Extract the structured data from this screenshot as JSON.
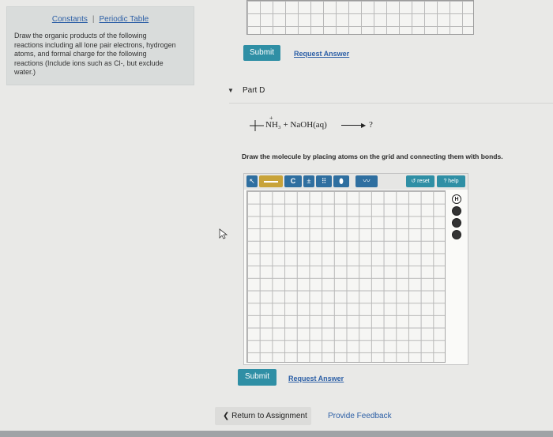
{
  "info": {
    "constants_link": "Constants",
    "periodic_link": "Periodic Table",
    "instructions_lines": [
      "Draw the organic products of the following",
      "reactions including all lone pair electrons, hydrogen",
      "atoms, and formal charge for the following",
      "reactions (Include ions such as Cl-, but exclude",
      "water.)"
    ]
  },
  "previous_part": {
    "submit_label": "Submit",
    "request_answer_label": "Request Answer"
  },
  "part_d": {
    "title": "Part D",
    "equation": {
      "reactants": "NH₃ + NaOH(aq)",
      "product": "?",
      "charge": "+"
    },
    "prompt": "Draw the molecule by placing atoms on the grid and connecting them with bonds.",
    "toolbar": {
      "carbon_label": "C",
      "reset_label": "reset",
      "help_label": "? help"
    },
    "side_buttons": [
      "H",
      "",
      "",
      ""
    ],
    "submit_label": "Submit",
    "request_answer_label": "Request Answer"
  },
  "footer": {
    "return_label": "Return to Assignment",
    "feedback_label": "Provide Feedback"
  },
  "colors": {
    "accent": "#2f8fa5",
    "link": "#2c5fa6",
    "toolbar_dark": "#2f6fa0",
    "toolbar_yellow": "#c8a33a"
  }
}
